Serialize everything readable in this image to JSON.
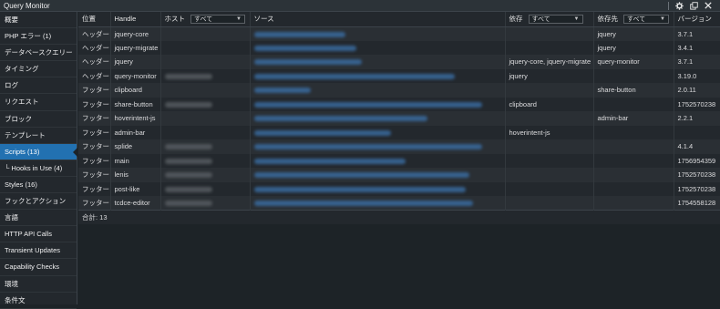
{
  "window": {
    "title": "Query Monitor"
  },
  "sidebar": {
    "items": [
      {
        "label": "概要"
      },
      {
        "label": "PHP エラー (1)"
      },
      {
        "label": "データベースクエリー"
      },
      {
        "label": "タイミング"
      },
      {
        "label": "ログ"
      },
      {
        "label": "リクエスト"
      },
      {
        "label": "ブロック"
      },
      {
        "label": "テンプレート"
      },
      {
        "label": "Scripts (13)",
        "active": true
      },
      {
        "label": "└ Hooks in Use (4)"
      },
      {
        "label": "Styles (16)"
      },
      {
        "label": "フックとアクション"
      },
      {
        "label": "言語"
      },
      {
        "label": "HTTP API Calls"
      },
      {
        "label": "Transient Updates"
      },
      {
        "label": "Capability Checks"
      },
      {
        "label": "環境"
      },
      {
        "label": "条件文"
      }
    ]
  },
  "table": {
    "headers": {
      "position": "位置",
      "handle": "Handle",
      "host": "ホスト",
      "host_filter": "すべて",
      "source": "ソース",
      "deps": "依存",
      "deps_filter": "すべて",
      "dependents": "依存先",
      "dependents_filter": "すべて",
      "version": "バージョン"
    },
    "rows": [
      {
        "position": "ヘッダー",
        "handle": "jquery-core",
        "host": "",
        "deps": "",
        "dependents": "jquery",
        "version": "3.7.1"
      },
      {
        "position": "ヘッダー",
        "handle": "jquery-migrate",
        "host": "",
        "deps": "",
        "dependents": "jquery",
        "version": "3.4.1"
      },
      {
        "position": "ヘッダー",
        "handle": "jquery",
        "host": "",
        "deps": "jquery-core, jquery-migrate",
        "dependents": "query-monitor",
        "version": "3.7.1"
      },
      {
        "position": "ヘッダー",
        "handle": "query-monitor",
        "host": "blur",
        "deps": "jquery",
        "dependents": "",
        "version": "3.19.0"
      },
      {
        "position": "フッター",
        "handle": "clipboard",
        "host": "",
        "deps": "",
        "dependents": "share-button",
        "version": "2.0.11"
      },
      {
        "position": "フッター",
        "handle": "share-button",
        "host": "blur",
        "deps": "clipboard",
        "dependents": "",
        "version": "1752570238"
      },
      {
        "position": "フッター",
        "handle": "hoverintent-js",
        "host": "",
        "deps": "",
        "dependents": "admin-bar",
        "version": "2.2.1"
      },
      {
        "position": "フッター",
        "handle": "admin-bar",
        "host": "",
        "deps": "hoverintent-js",
        "dependents": "",
        "version": ""
      },
      {
        "position": "フッター",
        "handle": "splide",
        "host": "blur",
        "deps": "",
        "dependents": "",
        "version": "4.1.4"
      },
      {
        "position": "フッター",
        "handle": "main",
        "host": "blur",
        "deps": "",
        "dependents": "",
        "version": "1756954359"
      },
      {
        "position": "フッター",
        "handle": "lenis",
        "host": "blur",
        "deps": "",
        "dependents": "",
        "version": "1752570238"
      },
      {
        "position": "フッター",
        "handle": "post-like",
        "host": "blur",
        "deps": "",
        "dependents": "",
        "version": "1752570238"
      },
      {
        "position": "フッター",
        "handle": "tcdce-editor",
        "host": "blur",
        "deps": "",
        "dependents": "",
        "version": "1754558128"
      }
    ],
    "footer": "合計: 13"
  },
  "icons": {
    "settings": "gear-icon",
    "popout": "popout-icon",
    "close": "close-icon"
  },
  "colors": {
    "accent": "#2271b1",
    "background": "#1d2327"
  }
}
